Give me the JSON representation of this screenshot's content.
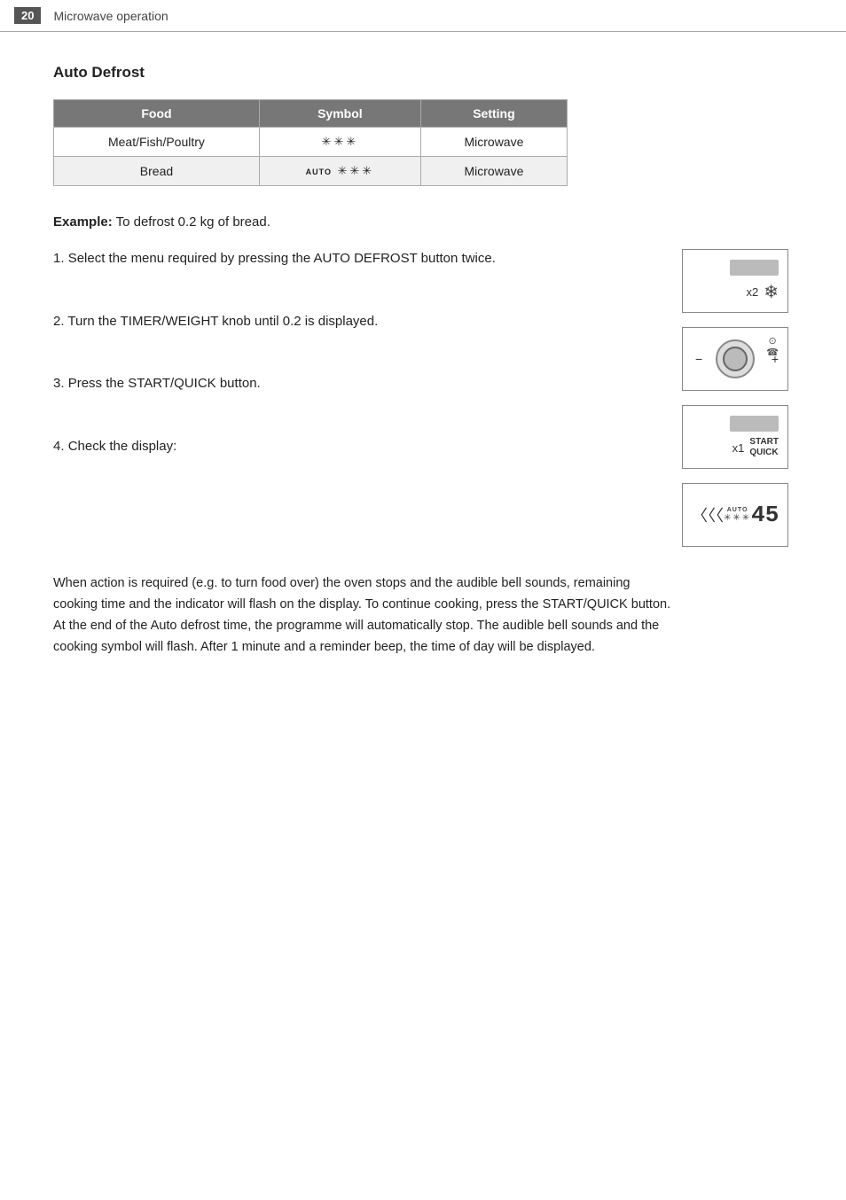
{
  "header": {
    "page_number": "20",
    "title": "Microwave operation"
  },
  "section": {
    "title": "Auto Defrost"
  },
  "table": {
    "columns": [
      "Food",
      "Symbol",
      "Setting"
    ],
    "rows": [
      {
        "food": "Meat/Fish/Poultry",
        "symbol": "❄❄❄",
        "setting": "Microwave"
      },
      {
        "food": "Bread",
        "symbol": "AUTO ❄❄❄",
        "setting": "Microwave"
      }
    ]
  },
  "example": {
    "label": "Example:",
    "text": " To defrost 0.2 kg of bread."
  },
  "steps": [
    {
      "number": "1.",
      "text": "Select the menu required by pressing the AUTO DEFROST button twice."
    },
    {
      "number": "2.",
      "text": "Turn the TIMER/WEIGHT knob until 0.2 is displayed."
    },
    {
      "number": "3.",
      "text": "Press the START/QUICK button."
    },
    {
      "number": "4.",
      "text": "Check the display:"
    }
  ],
  "diagrams": [
    {
      "label": "auto-defrost-button-x2",
      "x_label": "x2",
      "icon": "❄"
    },
    {
      "label": "timer-weight-knob",
      "minus": "−",
      "plus": "+"
    },
    {
      "label": "start-quick-button-x1",
      "x_label": "x1",
      "button_line1": "START",
      "button_line2": "QUICK"
    },
    {
      "label": "display-showing-45",
      "auto_text": "AUTO",
      "dots": "❄❄❄",
      "number": "45"
    }
  ],
  "info_paragraph": "When action is required (e.g. to turn food over) the oven stops and the audible bell sounds, remaining cooking time and the indicator will flash on the display. To continue cooking, press the START/QUICK button. At the end of the Auto defrost time, the programme will automatically stop. The audible bell sounds and the cooking symbol will flash. After 1 minute and a reminder beep, the time of day will be displayed."
}
